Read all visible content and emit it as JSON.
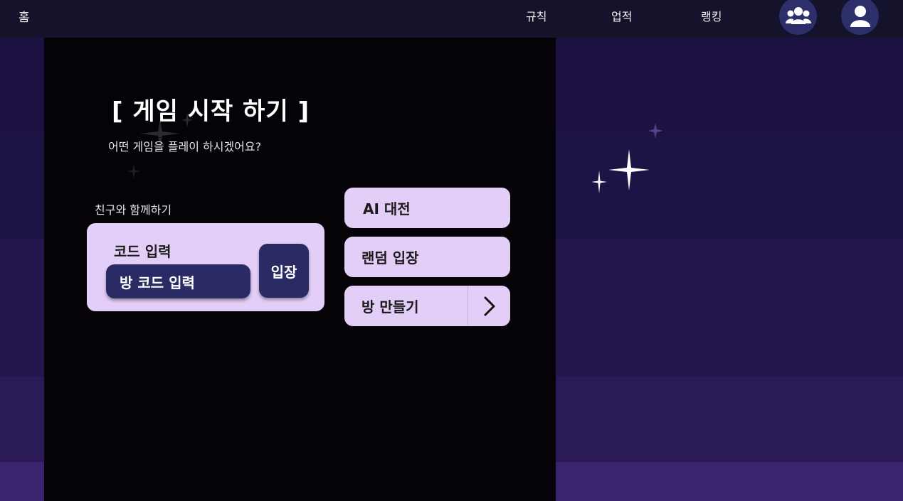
{
  "nav": {
    "home": "홈",
    "rules": "규칙",
    "achievements": "업적",
    "ranking": "랭킹",
    "friends_icon": "users-icon",
    "profile_icon": "user-icon"
  },
  "main": {
    "title": "[ 게임 시작 하기 ]",
    "subtitle": "어떤 게임을 플레이 하시겠어요?",
    "friends_section_label": "친구와 함께하기",
    "code_card": {
      "label": "코드 입력",
      "input_value": "방 코드 입력",
      "enter_button": "입장"
    },
    "modes": {
      "ai": "AI 대전",
      "random": "랜덤 입장",
      "create": "방 만들기"
    }
  },
  "colors": {
    "panel": "#050308",
    "card": "#e3cef7",
    "button_dark": "#2a2a64",
    "topbar": "#15122b"
  }
}
